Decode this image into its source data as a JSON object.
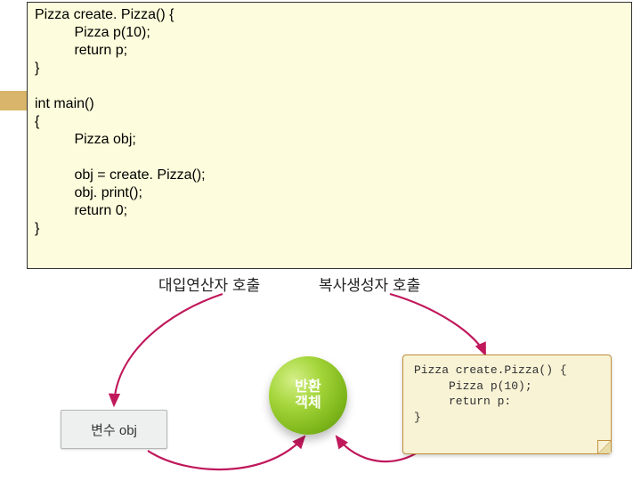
{
  "code_block": "Pizza create. Pizza() {\n          Pizza p(10);\n          return p;\n}\n\nint main()\n{\n          Pizza obj;\n\n          obj = create. Pizza();\n          obj. print();\n          return 0;\n}",
  "diagram": {
    "arc_left_label": "대입연산자 호출",
    "arc_right_label": "복사생성자 호출",
    "var_box_label": "변수 obj",
    "sphere_line1": "반환",
    "sphere_line2": "객체",
    "callout_code": "Pizza create.Pizza() {\n     Pizza p(10);\n     return p:\n}"
  }
}
